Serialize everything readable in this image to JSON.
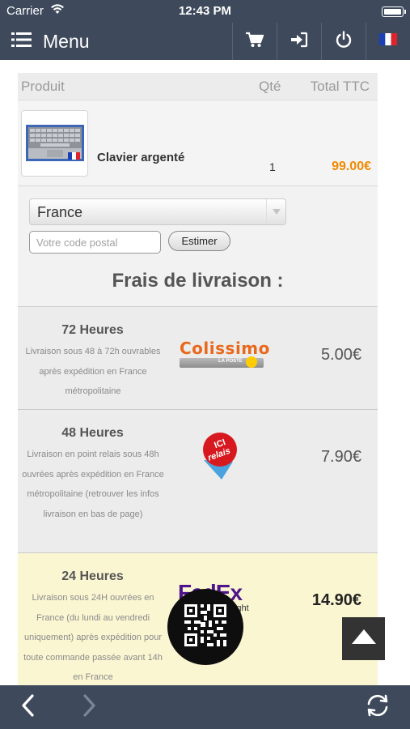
{
  "status_bar": {
    "carrier": "Carrier",
    "time": "12:43 PM"
  },
  "navbar": {
    "menu_label": "Menu",
    "icons": [
      "cart-icon",
      "sign-in-icon",
      "power-icon",
      "france-flag-icon"
    ]
  },
  "cart": {
    "headers": {
      "product": "Produit",
      "qty": "Qté",
      "total": "Total TTC"
    },
    "items": [
      {
        "name": "Clavier argenté",
        "qty": "1",
        "total": "99.00€"
      }
    ]
  },
  "shipping_form": {
    "country": "France",
    "postal_placeholder": "Votre code postal",
    "estimate_label": "Estimer",
    "title": "Frais de livraison :"
  },
  "shipping_options": [
    {
      "name": "72 Heures",
      "description": "Livraison sous 48 à 72h ouvrables après expédition en France métropolitaine",
      "carrier_logo": "Colissimo",
      "carrier_sub": "LA POSTE",
      "price": "5.00€",
      "selected": false
    },
    {
      "name": "48 Heures",
      "description": "Livraison en point relais sous 48h ouvrées après expédition en France métropolitaine (retrouver les infos livraison en bas de page)",
      "carrier_logo": "ICI relais",
      "price": "7.90€",
      "selected": false
    },
    {
      "name": "24 Heures",
      "description": "Livraison sous 24H ouvrées en France (du lundi au vendredi uniquement) après expédition pour toute commande passée avant 14h en France",
      "carrier_logo": "FedEx",
      "carrier_sub": "Overnight",
      "price": "14.90€",
      "selected": true
    }
  ],
  "colors": {
    "bar": "#3e4a5c",
    "price_accent": "#f08a00",
    "selected_row": "#fbf6d2"
  },
  "bottom_bar": {
    "icons": [
      "back-arrow-icon",
      "forward-arrow-icon",
      "refresh-icon"
    ]
  }
}
